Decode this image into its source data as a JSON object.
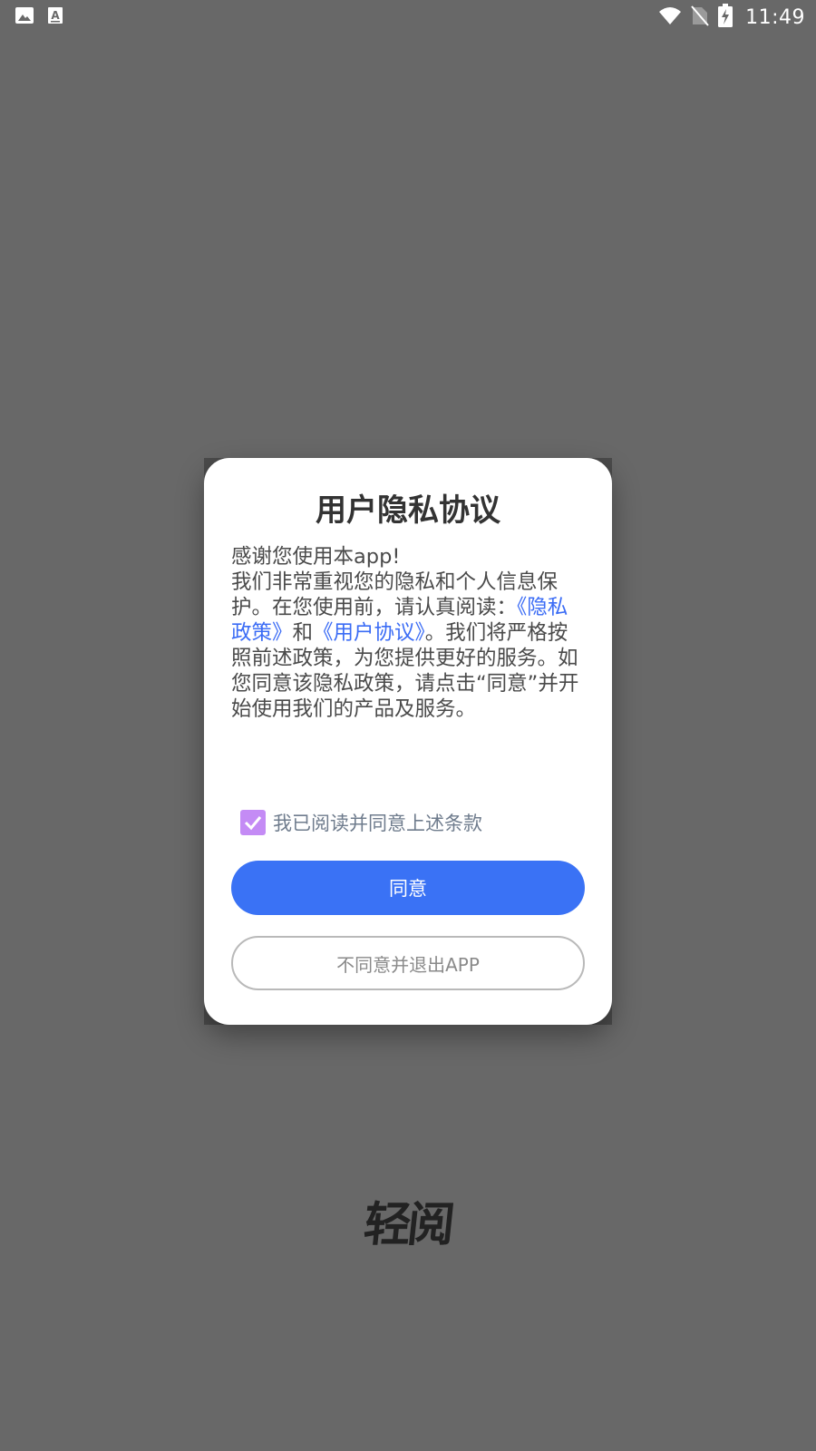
{
  "status_bar": {
    "time": "11:49",
    "left_icons": [
      "gallery-icon",
      "font-a-icon"
    ],
    "right_icons": [
      "wifi-icon",
      "no-sim-icon",
      "battery-charging-icon"
    ]
  },
  "dialog": {
    "title": "用户隐私协议",
    "body": {
      "greeting": "感谢您使用本app!",
      "text_before_links": "我们非常重视您的隐私和个人信息保护。在您使用前，请认真阅读：",
      "privacy_link": "《隐私政策》",
      "conjunction": "和",
      "user_agreement_link": "《用户协议》",
      "text_after_links": "。我们将严格按照前述政策，为您提供更好的服务。如您同意该隐私政策，请点击“同意”并开始使用我们的产品及服务。"
    },
    "checkbox": {
      "checked": true,
      "label": "我已阅读并同意上述条款"
    },
    "agree_button": "同意",
    "decline_button": "不同意并退出APP"
  },
  "logo": {
    "text": "轻阅"
  },
  "colors": {
    "background": "#686868",
    "dialog": "#ffffff",
    "primary_button": "#3a72f5",
    "link": "#3b6cf5",
    "checkbox": "#c48bf5"
  }
}
